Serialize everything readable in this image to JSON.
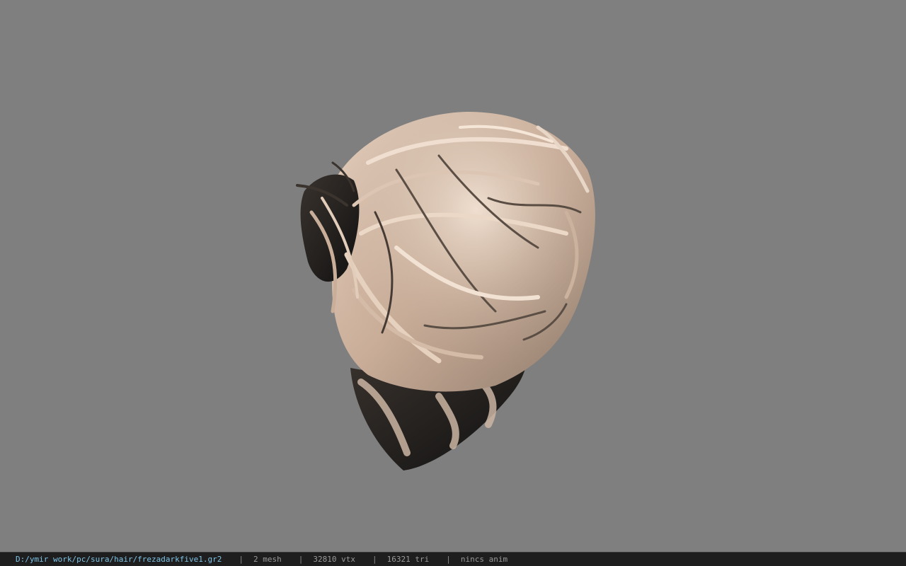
{
  "viewer": {
    "background_color": "#7f7f7f",
    "model_icon": "3d-hair-mesh"
  },
  "statusbar": {
    "file_path": "D:/ymir work/pc/sura/hair/frezadarkfive1.gr2",
    "separator": "|",
    "mesh": "2 mesh",
    "vertices": "32810 vtx",
    "triangles": "16321 tri",
    "anim": "nincs anim",
    "path_color": "#7ec3e6"
  }
}
